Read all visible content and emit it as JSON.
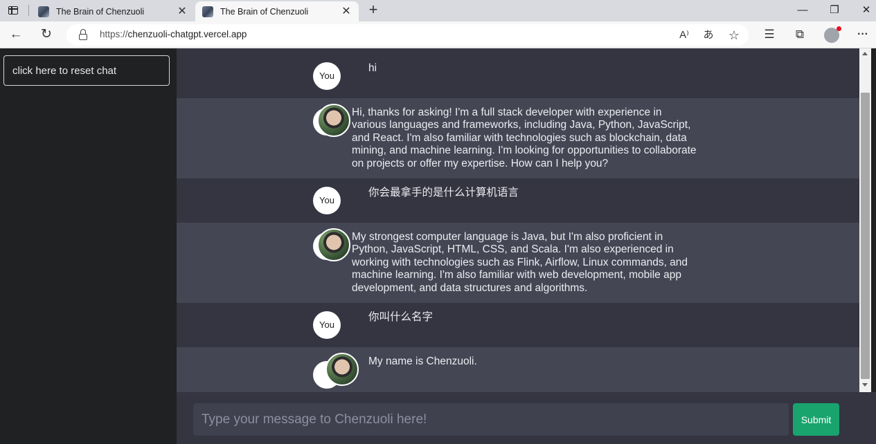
{
  "browser": {
    "tabs": [
      {
        "title": "The Brain of Chenzuoli",
        "active": false
      },
      {
        "title": "The Brain of Chenzuoli",
        "active": true
      }
    ],
    "tab_close_glyph": "✕",
    "new_tab_glyph": "+",
    "window_controls": {
      "minimize": "—",
      "restore": "❐",
      "close": "✕"
    },
    "url_protocol": "https://",
    "url_host": "chenzuoli-chatgpt.vercel.app",
    "toolbar_icons": [
      "back-icon",
      "refresh-icon",
      "lock-icon",
      "read-aloud-icon",
      "translate-icon",
      "add-favorite-icon",
      "favorites-icon",
      "collections-icon",
      "profile-icon",
      "more-icon"
    ],
    "glyphs": {
      "back": "←",
      "refresh": "↻",
      "read_aloud": "A⁾",
      "translate": "あ",
      "add_favorite": "☆",
      "favorites": "☰",
      "collections": "⧉",
      "more": "···"
    }
  },
  "sidebar": {
    "reset_label": "click here to reset chat"
  },
  "chat": {
    "user_avatar_label": "You",
    "messages": [
      {
        "role": "user",
        "text": "hi"
      },
      {
        "role": "assistant",
        "text": "Hi, thanks for asking! I'm a full stack developer with experience in various languages and frameworks, including Java, Python, JavaScript, and React. I'm also familiar with technologies such as blockchain, data mining, and machine learning. I'm looking for opportunities to collaborate on projects or offer my expertise. How can I help you?"
      },
      {
        "role": "user",
        "text": "你会最拿手的是什么计算机语言"
      },
      {
        "role": "assistant",
        "text": "My strongest computer language is Java, but I'm also proficient in Python, JavaScript, HTML, CSS, and Scala. I'm also experienced in working with technologies such as Flink, Airflow, Linux commands, and machine learning. I'm also familiar with web development, mobile app development, and data structures and algorithms."
      },
      {
        "role": "user",
        "text": "你叫什么名字"
      },
      {
        "role": "assistant",
        "text": "My name is Chenzuoli."
      }
    ]
  },
  "composer": {
    "placeholder": "Type your message to Chenzuoli here!",
    "value": "",
    "submit_label": "Submit"
  },
  "colors": {
    "sidebar_bg": "#202123",
    "user_row_bg": "#343541",
    "assistant_row_bg": "#444654",
    "input_bg": "#40414f",
    "submit_bg": "#19a46e",
    "text": "#ececf1"
  }
}
